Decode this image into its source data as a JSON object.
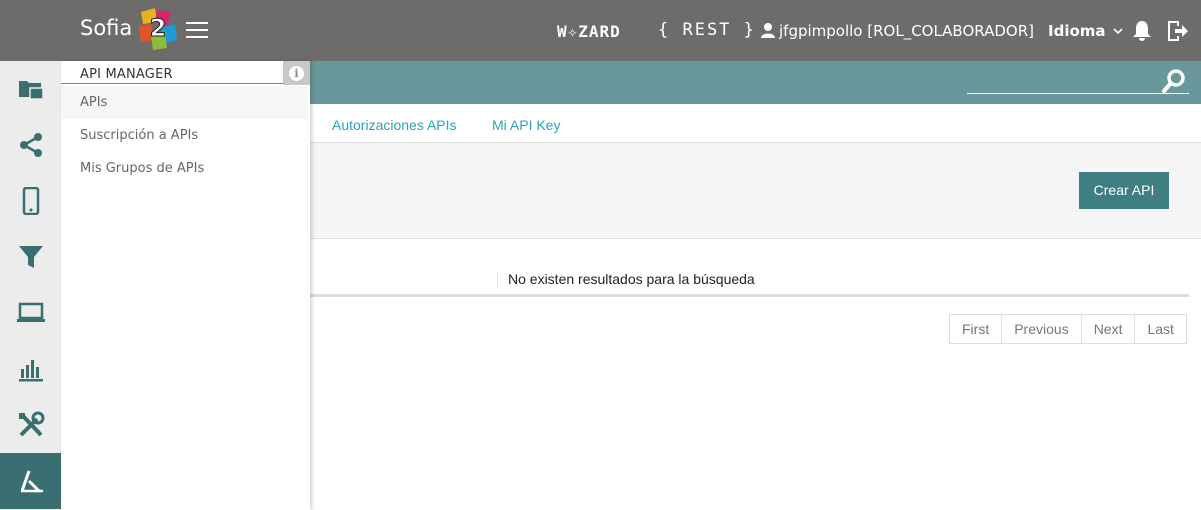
{
  "header": {
    "brand": "Sofia",
    "brand_mark": "2",
    "wizard": "W✧ZARD",
    "rest": "{ REST }",
    "user": "jfgpimpollo [ROL_COLABORADOR]",
    "language": "Idioma"
  },
  "left_nav": [
    {
      "icon": "folder-icon"
    },
    {
      "icon": "share-icon"
    },
    {
      "icon": "mobile-icon"
    },
    {
      "icon": "filter-icon"
    },
    {
      "icon": "laptop-icon"
    },
    {
      "icon": "bar-chart-icon"
    },
    {
      "icon": "tools-icon"
    },
    {
      "icon": "api-icon",
      "active": true
    }
  ],
  "submenu": {
    "title": "API MANAGER",
    "items": [
      {
        "label": "APIs",
        "active": true
      },
      {
        "label": "Suscripción a APIs"
      },
      {
        "label": "Mis Grupos de APIs"
      }
    ]
  },
  "tabs": [
    {
      "label": "Autorizaciones APIs"
    },
    {
      "label": "Mi API Key"
    }
  ],
  "toolbar": {
    "create_label": "Crear API"
  },
  "results": {
    "empty_message": "No existen resultados para la búsqueda"
  },
  "pagination": {
    "first": "First",
    "previous": "Previous",
    "next": "Next",
    "last": "Last"
  },
  "colors": {
    "topbar": "#6e6c6a",
    "teal_bar": "#6a9799",
    "active_nav": "#3b6e71",
    "button": "#3f7f82",
    "link": "#2aa3b5"
  }
}
